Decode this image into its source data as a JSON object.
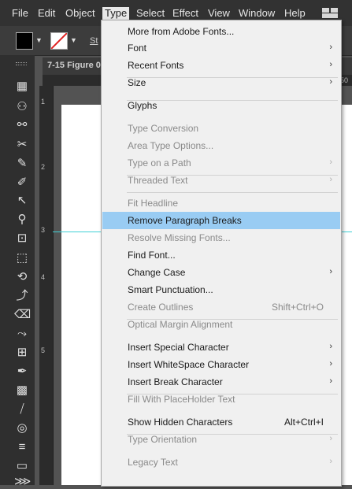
{
  "menubar": {
    "items": [
      "File",
      "Edit",
      "Object",
      "Type",
      "Select",
      "Effect",
      "View",
      "Window",
      "Help"
    ]
  },
  "options_bar": {
    "style_label": "St"
  },
  "document": {
    "tab_title": "7-15 Figure 0",
    "tab_zoom": "@",
    "ruler_top": "50"
  },
  "rulers": {
    "left": [
      "1",
      "2",
      "3",
      "4",
      "5"
    ]
  },
  "type_menu": {
    "items": [
      {
        "label": "More from Adobe Fonts...",
        "enabled": true
      },
      {
        "label": "Font",
        "enabled": true,
        "submenu": true
      },
      {
        "label": "Recent Fonts",
        "enabled": true,
        "submenu": true
      },
      {
        "label": "Size",
        "enabled": true,
        "submenu": true
      },
      {
        "label": "Glyphs",
        "enabled": true
      },
      {
        "label": "Type Conversion",
        "enabled": false
      },
      {
        "label": "Area Type Options...",
        "enabled": false
      },
      {
        "label": "Type on a Path",
        "enabled": false,
        "submenu": true
      },
      {
        "label": "Threaded Text",
        "enabled": false,
        "submenu": true
      },
      {
        "label": "Fit Headline",
        "enabled": false
      },
      {
        "label": "Remove Paragraph Breaks",
        "enabled": true,
        "highlighted": true
      },
      {
        "label": "Resolve Missing Fonts...",
        "enabled": false
      },
      {
        "label": "Find Font...",
        "enabled": true
      },
      {
        "label": "Change Case",
        "enabled": true,
        "submenu": true
      },
      {
        "label": "Smart Punctuation...",
        "enabled": true
      },
      {
        "label": "Create Outlines",
        "enabled": false,
        "shortcut": "Shift+Ctrl+O"
      },
      {
        "label": "Optical Margin Alignment",
        "enabled": false
      },
      {
        "label": "Insert Special Character",
        "enabled": true,
        "submenu": true
      },
      {
        "label": "Insert WhiteSpace Character",
        "enabled": true,
        "submenu": true
      },
      {
        "label": "Insert Break Character",
        "enabled": true,
        "submenu": true
      },
      {
        "label": "Fill With PlaceHolder Text",
        "enabled": false
      },
      {
        "label": "Show Hidden Characters",
        "enabled": true,
        "shortcut": "Alt+Ctrl+I"
      },
      {
        "label": "Type Orientation",
        "enabled": false,
        "submenu": true
      },
      {
        "label": "Legacy Text",
        "enabled": false,
        "submenu": true
      }
    ]
  },
  "colors": {
    "menu_highlight": "#99ccf3",
    "guide": "#3fd0d6",
    "stroke_none_slash": "#e02020"
  }
}
